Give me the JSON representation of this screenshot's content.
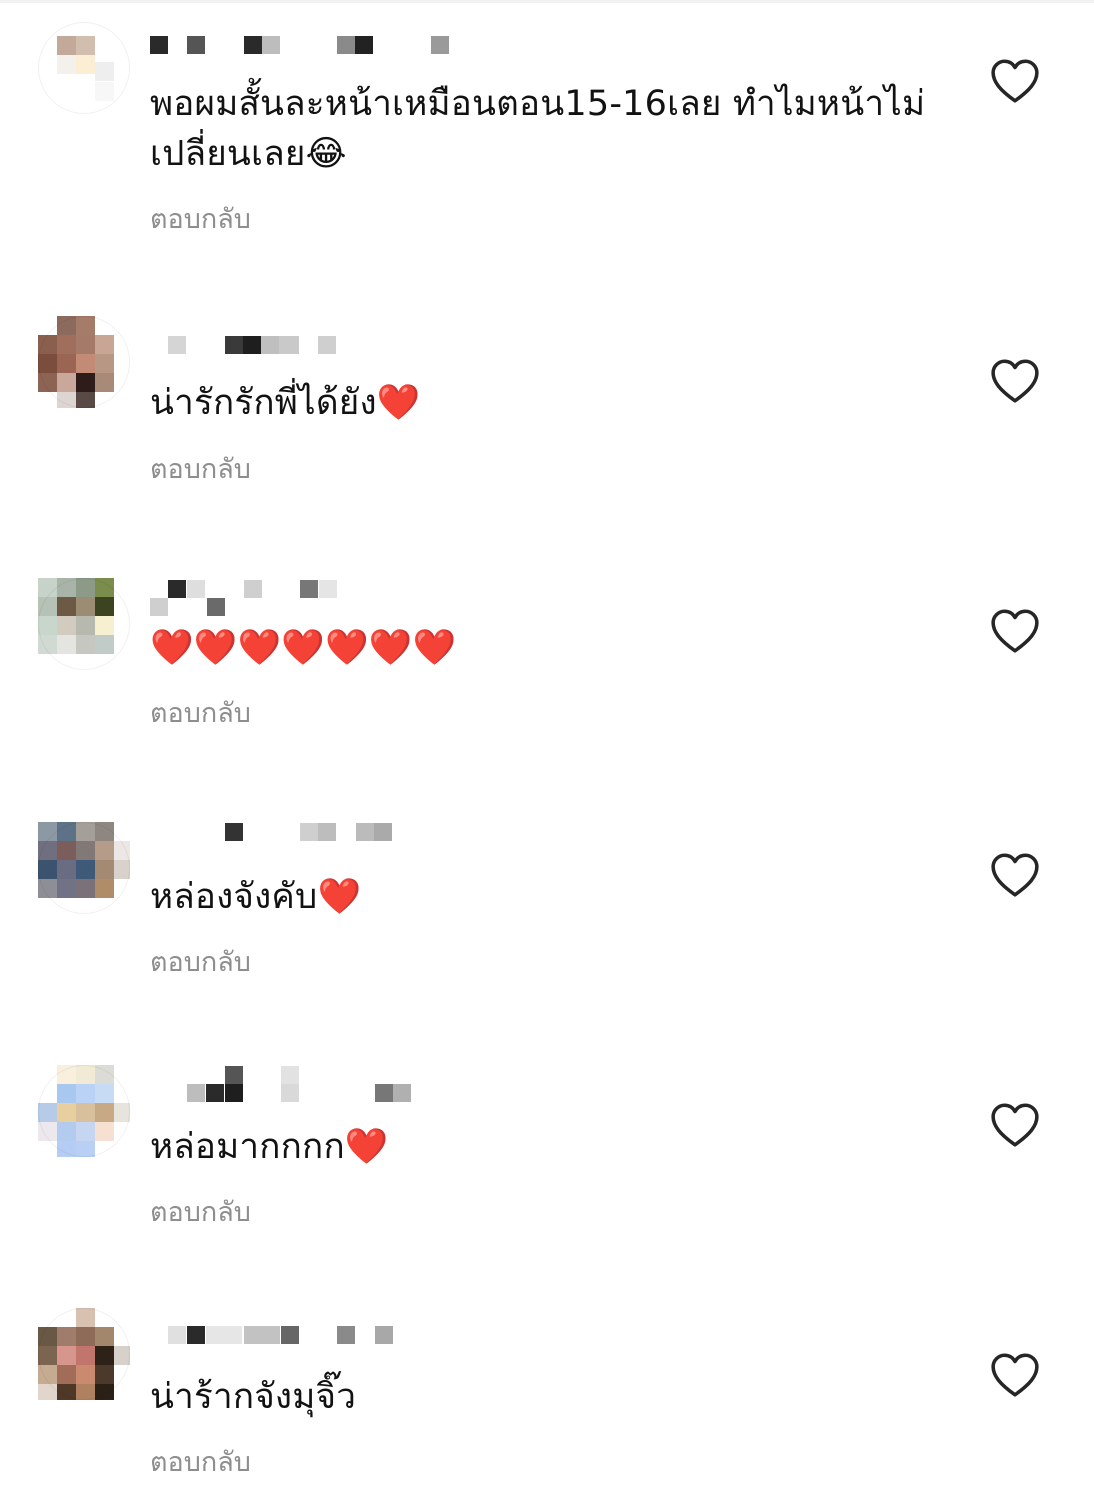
{
  "comments": [
    {
      "text": "พอผมสั้นละหน้าเหมือนตอน15-16เลย ทำไมหน้าไม่เปลี่ยนเลย😂",
      "reply_label": "ตอบกลับ",
      "like_icon": "heart-outline-icon"
    },
    {
      "text": "น่ารักรักพี่ได้ยัง❤️",
      "reply_label": "ตอบกลับ",
      "like_icon": "heart-outline-icon"
    },
    {
      "text": "❤️❤️❤️❤️❤️❤️❤️",
      "reply_label": "ตอบกลับ",
      "like_icon": "heart-outline-icon"
    },
    {
      "text": "หล่องจังคับ❤️",
      "reply_label": "ตอบกลับ",
      "like_icon": "heart-outline-icon"
    },
    {
      "text": "หล่อมากกกก❤️",
      "reply_label": "ตอบกลับ",
      "like_icon": "heart-outline-icon"
    },
    {
      "text": "น่าร้ากจังมุจิ๊ว",
      "reply_label": "ตอบกลับ",
      "like_icon": "heart-outline-icon"
    }
  ],
  "colors": {
    "text": "#121212",
    "secondary_text": "#8e8e8e",
    "icon_stroke": "#262626",
    "background": "#ffffff"
  }
}
